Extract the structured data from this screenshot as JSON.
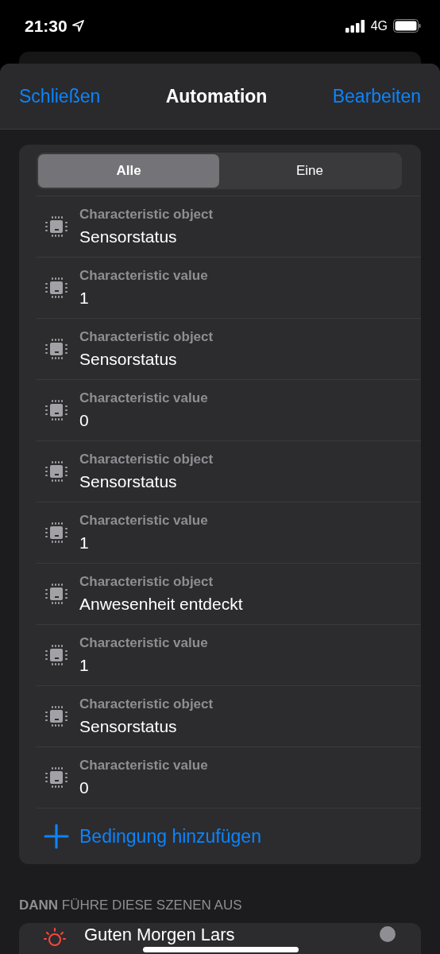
{
  "status_bar": {
    "time": "21:30",
    "network": "4G"
  },
  "nav": {
    "left": "Schließen",
    "title": "Automation",
    "right": "Bearbeiten"
  },
  "segments": [
    {
      "label": "Alle",
      "selected": true
    },
    {
      "label": "Eine",
      "selected": false
    }
  ],
  "conditions": [
    {
      "label": "Characteristic object",
      "value": "Sensorstatus"
    },
    {
      "label": "Characteristic value",
      "value": "1"
    },
    {
      "label": "Characteristic object",
      "value": "Sensorstatus"
    },
    {
      "label": "Characteristic value",
      "value": "0"
    },
    {
      "label": "Characteristic object",
      "value": "Sensorstatus"
    },
    {
      "label": "Characteristic value",
      "value": "1"
    },
    {
      "label": "Characteristic object",
      "value": "Anwesenheit entdeckt"
    },
    {
      "label": "Characteristic value",
      "value": "1"
    },
    {
      "label": "Characteristic object",
      "value": "Sensorstatus"
    },
    {
      "label": "Characteristic value",
      "value": "0"
    }
  ],
  "add_condition": "Bedingung hinzufügen",
  "scenes_header": "**DANN** FÜHRE DIESE SZENEN AUS",
  "scenes": [
    {
      "name": "Guten Morgen Lars",
      "selected": false
    }
  ]
}
